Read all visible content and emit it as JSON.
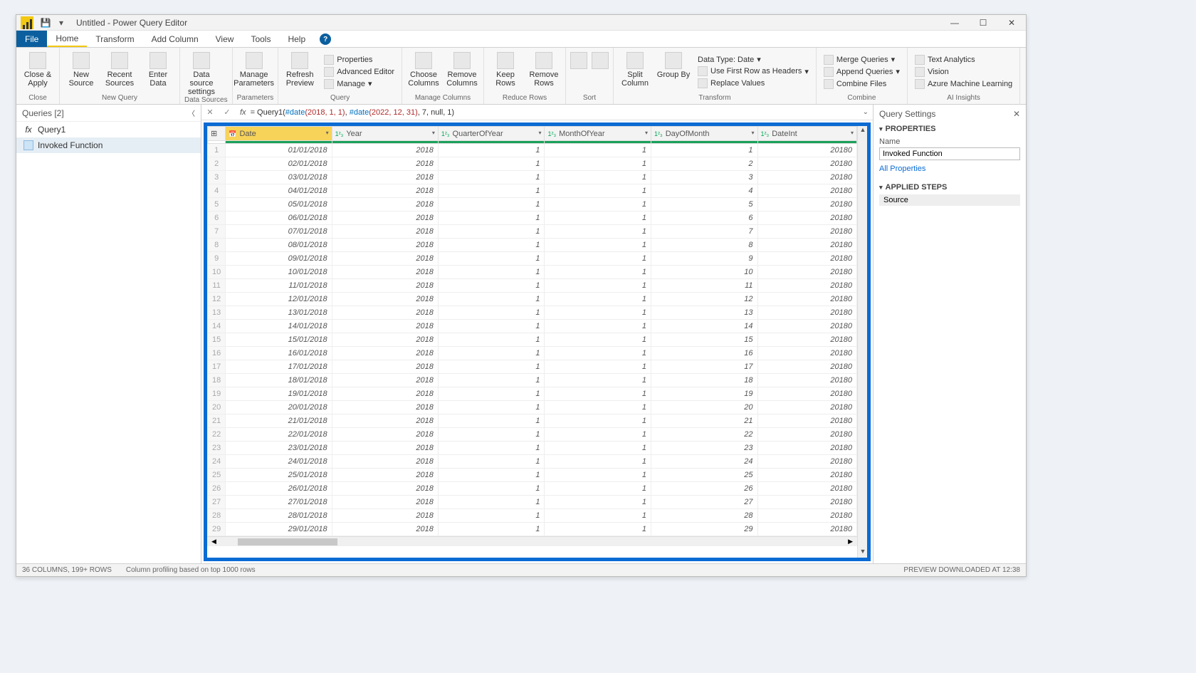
{
  "title": "Untitled - Power Query Editor",
  "menu": {
    "file": "File",
    "home": "Home",
    "transform": "Transform",
    "addcol": "Add Column",
    "view": "View",
    "tools": "Tools",
    "help": "Help"
  },
  "ribbon": {
    "close": {
      "btn": "Close & Apply",
      "grp": "Close"
    },
    "newquery": {
      "new": "New Source",
      "recent": "Recent Sources",
      "enter": "Enter Data",
      "grp": "New Query"
    },
    "datasources": {
      "settings": "Data source settings",
      "grp": "Data Sources"
    },
    "parameters": {
      "manage": "Manage Parameters",
      "grp": "Parameters"
    },
    "query": {
      "refresh": "Refresh Preview",
      "props": "Properties",
      "adved": "Advanced Editor",
      "manage": "Manage",
      "grp": "Query"
    },
    "managecols": {
      "choose": "Choose Columns",
      "remove": "Remove Columns",
      "grp": "Manage Columns"
    },
    "reducerows": {
      "keep": "Keep Rows",
      "remove": "Remove Rows",
      "grp": "Reduce Rows"
    },
    "sort": {
      "grp": "Sort"
    },
    "transform": {
      "split": "Split Column",
      "group": "Group By",
      "dtype": "Data Type: Date",
      "firstrow": "Use First Row as Headers",
      "replace": "Replace Values",
      "grp": "Transform"
    },
    "combine": {
      "merge": "Merge Queries",
      "append": "Append Queries",
      "files": "Combine Files",
      "grp": "Combine"
    },
    "ai": {
      "text": "Text Analytics",
      "vision": "Vision",
      "aml": "Azure Machine Learning",
      "grp": "AI Insights"
    }
  },
  "queries": {
    "header": "Queries [2]",
    "q1": "Query1",
    "q2": "Invoked Function"
  },
  "formula": {
    "prefix": "= Query1(",
    "d1a": "#date",
    "d1b": "(2018, 1, 1)",
    "sep1": ", ",
    "d2a": "#date",
    "d2b": "(2022, 12, 31)",
    "tail": ", 7, null, 1)"
  },
  "columns": {
    "date": "Date",
    "year": "Year",
    "qoy": "QuarterOfYear",
    "moy": "MonthOfYear",
    "dom": "DayOfMonth",
    "dint": "DateInt"
  },
  "rows": [
    {
      "n": 1,
      "date": "01/01/2018",
      "year": "2018",
      "q": "1",
      "m": "1",
      "d": "1",
      "i": "20180"
    },
    {
      "n": 2,
      "date": "02/01/2018",
      "year": "2018",
      "q": "1",
      "m": "1",
      "d": "2",
      "i": "20180"
    },
    {
      "n": 3,
      "date": "03/01/2018",
      "year": "2018",
      "q": "1",
      "m": "1",
      "d": "3",
      "i": "20180"
    },
    {
      "n": 4,
      "date": "04/01/2018",
      "year": "2018",
      "q": "1",
      "m": "1",
      "d": "4",
      "i": "20180"
    },
    {
      "n": 5,
      "date": "05/01/2018",
      "year": "2018",
      "q": "1",
      "m": "1",
      "d": "5",
      "i": "20180"
    },
    {
      "n": 6,
      "date": "06/01/2018",
      "year": "2018",
      "q": "1",
      "m": "1",
      "d": "6",
      "i": "20180"
    },
    {
      "n": 7,
      "date": "07/01/2018",
      "year": "2018",
      "q": "1",
      "m": "1",
      "d": "7",
      "i": "20180"
    },
    {
      "n": 8,
      "date": "08/01/2018",
      "year": "2018",
      "q": "1",
      "m": "1",
      "d": "8",
      "i": "20180"
    },
    {
      "n": 9,
      "date": "09/01/2018",
      "year": "2018",
      "q": "1",
      "m": "1",
      "d": "9",
      "i": "20180"
    },
    {
      "n": 10,
      "date": "10/01/2018",
      "year": "2018",
      "q": "1",
      "m": "1",
      "d": "10",
      "i": "20180"
    },
    {
      "n": 11,
      "date": "11/01/2018",
      "year": "2018",
      "q": "1",
      "m": "1",
      "d": "11",
      "i": "20180"
    },
    {
      "n": 12,
      "date": "12/01/2018",
      "year": "2018",
      "q": "1",
      "m": "1",
      "d": "12",
      "i": "20180"
    },
    {
      "n": 13,
      "date": "13/01/2018",
      "year": "2018",
      "q": "1",
      "m": "1",
      "d": "13",
      "i": "20180"
    },
    {
      "n": 14,
      "date": "14/01/2018",
      "year": "2018",
      "q": "1",
      "m": "1",
      "d": "14",
      "i": "20180"
    },
    {
      "n": 15,
      "date": "15/01/2018",
      "year": "2018",
      "q": "1",
      "m": "1",
      "d": "15",
      "i": "20180"
    },
    {
      "n": 16,
      "date": "16/01/2018",
      "year": "2018",
      "q": "1",
      "m": "1",
      "d": "16",
      "i": "20180"
    },
    {
      "n": 17,
      "date": "17/01/2018",
      "year": "2018",
      "q": "1",
      "m": "1",
      "d": "17",
      "i": "20180"
    },
    {
      "n": 18,
      "date": "18/01/2018",
      "year": "2018",
      "q": "1",
      "m": "1",
      "d": "18",
      "i": "20180"
    },
    {
      "n": 19,
      "date": "19/01/2018",
      "year": "2018",
      "q": "1",
      "m": "1",
      "d": "19",
      "i": "20180"
    },
    {
      "n": 20,
      "date": "20/01/2018",
      "year": "2018",
      "q": "1",
      "m": "1",
      "d": "20",
      "i": "20180"
    },
    {
      "n": 21,
      "date": "21/01/2018",
      "year": "2018",
      "q": "1",
      "m": "1",
      "d": "21",
      "i": "20180"
    },
    {
      "n": 22,
      "date": "22/01/2018",
      "year": "2018",
      "q": "1",
      "m": "1",
      "d": "22",
      "i": "20180"
    },
    {
      "n": 23,
      "date": "23/01/2018",
      "year": "2018",
      "q": "1",
      "m": "1",
      "d": "23",
      "i": "20180"
    },
    {
      "n": 24,
      "date": "24/01/2018",
      "year": "2018",
      "q": "1",
      "m": "1",
      "d": "24",
      "i": "20180"
    },
    {
      "n": 25,
      "date": "25/01/2018",
      "year": "2018",
      "q": "1",
      "m": "1",
      "d": "25",
      "i": "20180"
    },
    {
      "n": 26,
      "date": "26/01/2018",
      "year": "2018",
      "q": "1",
      "m": "1",
      "d": "26",
      "i": "20180"
    },
    {
      "n": 27,
      "date": "27/01/2018",
      "year": "2018",
      "q": "1",
      "m": "1",
      "d": "27",
      "i": "20180"
    },
    {
      "n": 28,
      "date": "28/01/2018",
      "year": "2018",
      "q": "1",
      "m": "1",
      "d": "28",
      "i": "20180"
    },
    {
      "n": 29,
      "date": "29/01/2018",
      "year": "2018",
      "q": "1",
      "m": "1",
      "d": "29",
      "i": "20180"
    }
  ],
  "settings": {
    "title": "Query Settings",
    "props": "PROPERTIES",
    "name_lbl": "Name",
    "name_val": "Invoked Function",
    "allprops": "All Properties",
    "steps": "APPLIED STEPS",
    "step1": "Source"
  },
  "status": {
    "left1": "36 COLUMNS, 199+ ROWS",
    "left2": "Column profiling based on top 1000 rows",
    "right": "PREVIEW DOWNLOADED AT 12:38"
  }
}
